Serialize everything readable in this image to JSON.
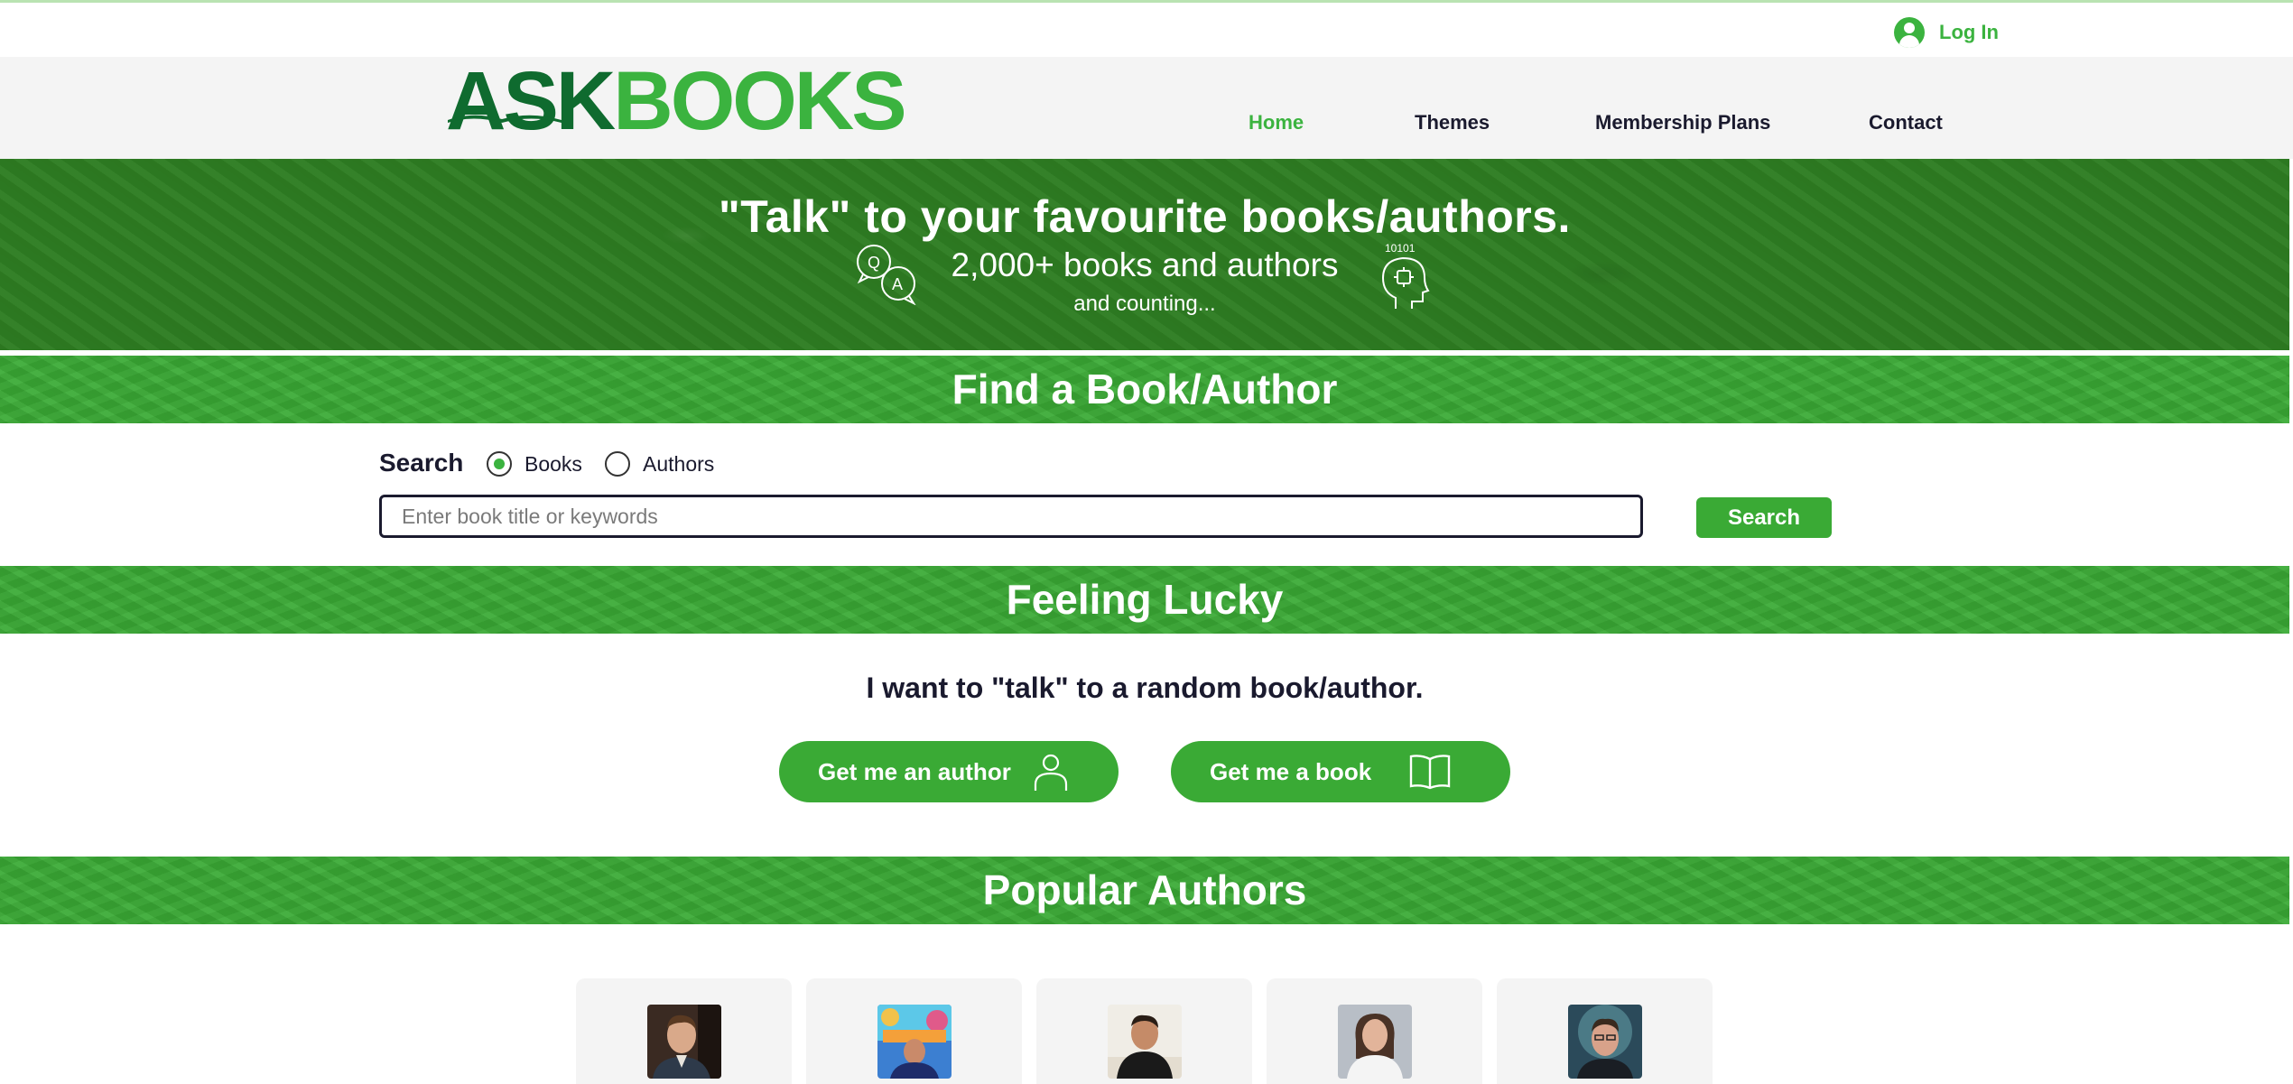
{
  "topbar": {
    "login_label": "Log In"
  },
  "brand": {
    "logo_ask": "ASK",
    "logo_books": "BOOKS",
    "colors": {
      "dark_green": "#0f6b2f",
      "green": "#3bb33f"
    }
  },
  "nav": {
    "items": [
      {
        "label": "Home",
        "active": true
      },
      {
        "label": "Themes",
        "active": false
      },
      {
        "label": "Membership Plans",
        "active": false
      },
      {
        "label": "Contact",
        "active": false
      }
    ]
  },
  "hero": {
    "title": "\"Talk\" to your favourite books/authors.",
    "subtitle": "2,000+ books and authors",
    "counting": "and counting...",
    "icons": [
      "qa-chat-icon",
      "binary-head-icon"
    ],
    "binary_text": "10101"
  },
  "find": {
    "heading": "Find a Book/Author",
    "search_label": "Search",
    "options": [
      {
        "label": "Books",
        "checked": true
      },
      {
        "label": "Authors",
        "checked": false
      }
    ],
    "placeholder": "Enter book title or keywords",
    "value": "",
    "button_label": "Search"
  },
  "lucky": {
    "heading": "Feeling Lucky",
    "text": "I want to \"talk\" to a random book/author.",
    "author_button": "Get me an author",
    "book_button": "Get me a book",
    "icons": [
      "person-icon",
      "open-book-icon"
    ]
  },
  "popular": {
    "heading": "Popular Authors",
    "authors": [
      {
        "avatar": "author-photo-1"
      },
      {
        "avatar": "author-photo-2"
      },
      {
        "avatar": "author-photo-3"
      },
      {
        "avatar": "author-photo-4"
      },
      {
        "avatar": "author-photo-5"
      }
    ]
  }
}
